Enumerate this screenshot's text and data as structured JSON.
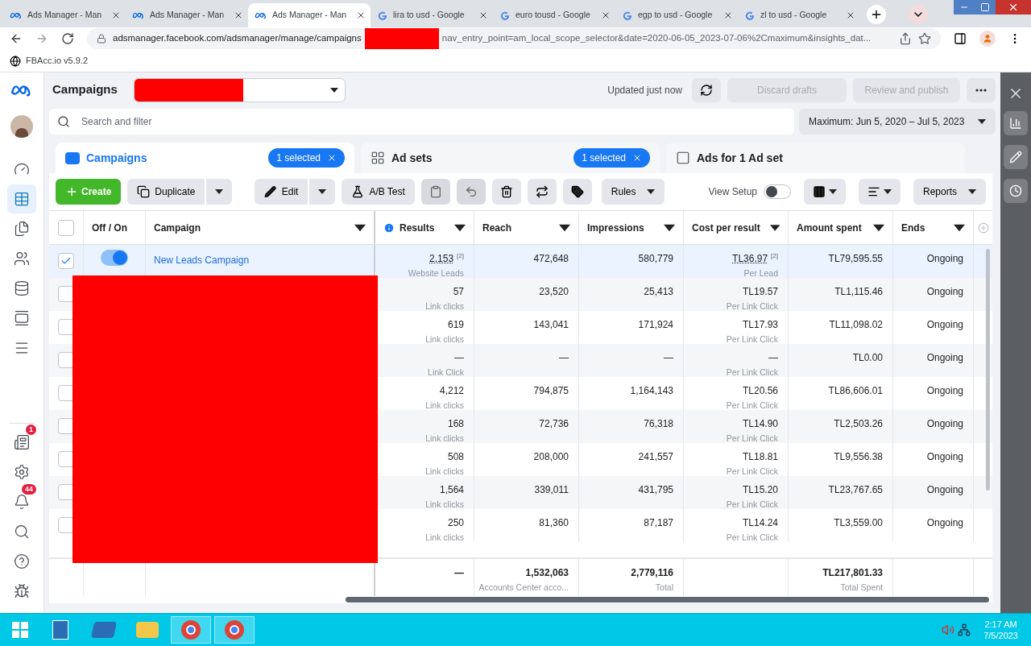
{
  "browser": {
    "tabs": [
      {
        "kind": "meta",
        "title": "Ads Manager - Man",
        "selected": false
      },
      {
        "kind": "meta",
        "title": "Ads Manager - Man",
        "selected": false
      },
      {
        "kind": "meta",
        "title": "Ads Manager - Man",
        "selected": true
      },
      {
        "kind": "google",
        "title": "lira to usd - Google",
        "selected": false
      },
      {
        "kind": "google",
        "title": "euro tousd - Google",
        "selected": false
      },
      {
        "kind": "google",
        "title": "egp to usd - Google",
        "selected": false
      },
      {
        "kind": "google",
        "title": "zl to usd - Google",
        "selected": false
      }
    ],
    "url_start": "adsmanager.facebook.com/adsmanager/manage/campaigns",
    "url_end": "nav_entry_point=am_local_scope_selector&date=2020-06-05_2023-07-06%2Cmaximum&insights_dat...",
    "bookmark": "FBAcc.io v5.9.2"
  },
  "nav": {
    "items": [
      {
        "kind": "gauge",
        "selected": false
      },
      {
        "kind": "table",
        "selected": true
      },
      {
        "kind": "pages",
        "selected": false
      },
      {
        "kind": "people",
        "selected": false
      },
      {
        "kind": "coins",
        "selected": false
      },
      {
        "kind": "ads",
        "selected": false
      },
      {
        "kind": "menu",
        "selected": false
      }
    ],
    "bottom": [
      {
        "kind": "news",
        "badge": "1"
      },
      {
        "kind": "settings"
      },
      {
        "kind": "bell",
        "badge": "44"
      },
      {
        "kind": "search"
      },
      {
        "kind": "help"
      },
      {
        "kind": "bug"
      }
    ]
  },
  "header": {
    "title": "Campaigns",
    "updated": "Updated just now",
    "discard": "Discard drafts",
    "publish": "Review and publish",
    "search_placeholder": "Search and filter",
    "date_range": "Maximum: Jun 5, 2020 – Jul 5, 2023"
  },
  "level_tabs": [
    {
      "label": "Campaigns",
      "selected": true,
      "badge": "1 selected"
    },
    {
      "label": "Ad sets",
      "selected": false,
      "badge": "1 selected"
    },
    {
      "label": "Ads for 1 Ad set",
      "selected": false
    }
  ],
  "toolbar": {
    "create": "Create",
    "duplicate": "Duplicate",
    "edit": "Edit",
    "ab_test": "A/B Test",
    "rules": "Rules",
    "view_setup": "View Setup",
    "view_setup_on": false,
    "reports": "Reports"
  },
  "table": {
    "select_all_checked": false,
    "columns": [
      "Off / On",
      "Campaign",
      "Results",
      "Reach",
      "Impressions",
      "Cost per result",
      "Amount spent",
      "Ends"
    ],
    "rows": [
      {
        "checked": true,
        "on": true,
        "campaign": "New Leads Campaign",
        "results": "2,153",
        "results_note": "[2]",
        "results_type": "Website Leads",
        "reach": "472,648",
        "impressions": "580,779",
        "cost": "TL36.97",
        "cost_note": "[2]",
        "cost_type": "Per Lead",
        "amount": "TL79,595.55",
        "ends": "Ongoing"
      },
      {
        "checked": false,
        "results": "57",
        "results_type": "Link clicks",
        "reach": "23,520",
        "impressions": "25,413",
        "cost": "TL19.57",
        "cost_type": "Per Link Click",
        "amount": "TL1,115.46",
        "ends": "Ongoing"
      },
      {
        "checked": false,
        "results": "619",
        "results_type": "Link clicks",
        "reach": "143,041",
        "impressions": "171,924",
        "cost": "TL17.93",
        "cost_type": "Per Link Click",
        "amount": "TL11,098.02",
        "ends": "Ongoing"
      },
      {
        "checked": false,
        "results": "—",
        "results_type": "Link Click",
        "reach": "—",
        "impressions": "—",
        "cost": "—",
        "cost_type": "Per Link Click",
        "amount": "TL0.00",
        "ends": "Ongoing"
      },
      {
        "checked": false,
        "results": "4,212",
        "results_type": "Link clicks",
        "reach": "794,875",
        "impressions": "1,164,143",
        "cost": "TL20.56",
        "cost_type": "Per Link Click",
        "amount": "TL86,606.01",
        "ends": "Ongoing"
      },
      {
        "checked": false,
        "results": "168",
        "results_type": "Link clicks",
        "reach": "72,736",
        "impressions": "76,318",
        "cost": "TL14.90",
        "cost_type": "Per Link Click",
        "amount": "TL2,503.26",
        "ends": "Ongoing"
      },
      {
        "checked": false,
        "results": "508",
        "results_type": "Link clicks",
        "reach": "208,000",
        "impressions": "241,557",
        "cost": "TL18.81",
        "cost_type": "Per Link Click",
        "amount": "TL9,556.38",
        "ends": "Ongoing"
      },
      {
        "checked": false,
        "results": "1,564",
        "results_type": "Link clicks",
        "reach": "339,011",
        "impressions": "431,795",
        "cost": "TL15.20",
        "cost_type": "Per Link Click",
        "amount": "TL23,767.65",
        "ends": "Ongoing"
      },
      {
        "checked": false,
        "results": "250",
        "results_type": "Link clicks",
        "reach": "81,360",
        "impressions": "87,187",
        "cost": "TL14.24",
        "cost_type": "Per Link Click",
        "amount": "TL3,559.00",
        "ends": "Ongoing"
      }
    ],
    "footer": {
      "results": "—",
      "reach": "1,532,063",
      "reach_note": "Accounts Center acco...",
      "impressions": "2,779,116",
      "impressions_note": "Total",
      "amount": "TL217,801.33",
      "amount_note": "Total Spent"
    }
  },
  "taskbar": {
    "time": "2:17 AM",
    "date": "7/5/2023"
  }
}
